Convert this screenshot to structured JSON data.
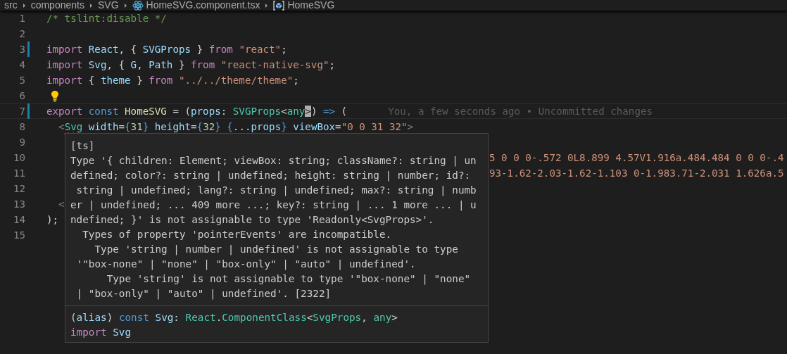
{
  "breadcrumbs": [
    {
      "kind": "text",
      "label": "src"
    },
    {
      "kind": "text",
      "label": "components"
    },
    {
      "kind": "text",
      "label": "SVG"
    },
    {
      "kind": "react",
      "label": "HomeSVG.component.tsx"
    },
    {
      "kind": "symbol",
      "label": "HomeSVG"
    }
  ],
  "lines": [
    {
      "number": "1",
      "modified": false,
      "current": false,
      "tokens": [
        {
          "kind": "comment",
          "text": "/* tslint:disable */"
        }
      ]
    },
    {
      "number": "2",
      "modified": false,
      "current": false
    },
    {
      "number": "3",
      "modified": true,
      "current": false,
      "tokens": [
        {
          "kind": "keyword",
          "text": "import "
        },
        {
          "kind": "var",
          "text": "React"
        },
        {
          "kind": "punc",
          "text": ", { "
        },
        {
          "kind": "var",
          "text": "SVGProps"
        },
        {
          "kind": "punc",
          "text": " } "
        },
        {
          "kind": "keyword",
          "text": "from "
        },
        {
          "kind": "string",
          "text": "\"react\""
        },
        {
          "kind": "punc",
          "text": ";"
        }
      ]
    },
    {
      "number": "4",
      "modified": false,
      "current": false,
      "tokens": [
        {
          "kind": "keyword",
          "text": "import "
        },
        {
          "kind": "var",
          "text": "Svg"
        },
        {
          "kind": "punc",
          "text": ", { "
        },
        {
          "kind": "var",
          "text": "G"
        },
        {
          "kind": "punc",
          "text": ", "
        },
        {
          "kind": "var",
          "text": "Path"
        },
        {
          "kind": "punc",
          "text": " } "
        },
        {
          "kind": "keyword",
          "text": "from "
        },
        {
          "kind": "string",
          "text": "\"react-native-svg\""
        },
        {
          "kind": "punc",
          "text": ";"
        }
      ]
    },
    {
      "number": "5",
      "modified": false,
      "current": false,
      "tokens": [
        {
          "kind": "keyword",
          "text": "import"
        },
        {
          "kind": "punc",
          "text": " { "
        },
        {
          "kind": "var",
          "text": "theme"
        },
        {
          "kind": "punc",
          "text": " } "
        },
        {
          "kind": "keyword",
          "text": "from "
        },
        {
          "kind": "string",
          "text": "\"../../theme/theme\""
        },
        {
          "kind": "punc",
          "text": ";"
        }
      ]
    },
    {
      "number": "6",
      "modified": false,
      "current": false,
      "tokens": [
        {
          "kind": "lightbulb"
        }
      ]
    },
    {
      "number": "7",
      "modified": true,
      "current": true,
      "blame": "You, a few seconds ago • Uncommitted changes",
      "tokens": [
        {
          "kind": "keyword",
          "text": "export "
        },
        {
          "kind": "storage",
          "text": "const "
        },
        {
          "kind": "function",
          "text": "HomeSVG"
        },
        {
          "kind": "punc",
          "text": " = ("
        },
        {
          "kind": "var",
          "text": "props"
        },
        {
          "kind": "punc",
          "text": ": "
        },
        {
          "kind": "type",
          "text": "SVGProps"
        },
        {
          "kind": "punc",
          "text": "<"
        },
        {
          "kind": "type",
          "text": "any"
        },
        {
          "kind": "punc",
          "text": ">",
          "cursor": true
        },
        {
          "kind": "punc",
          "text": ") "
        },
        {
          "kind": "storage",
          "text": "=>"
        },
        {
          "kind": "punc",
          "text": " ("
        }
      ]
    },
    {
      "number": "8",
      "modified": false,
      "current": false,
      "tokens": [
        {
          "kind": "tag",
          "text": "  <"
        },
        {
          "kind": "type",
          "text": "Svg",
          "error": true
        },
        {
          "kind": "var",
          "text": " width"
        },
        {
          "kind": "punc",
          "text": "="
        },
        {
          "kind": "storage",
          "text": "{"
        },
        {
          "kind": "number",
          "text": "31"
        },
        {
          "kind": "storage",
          "text": "}"
        },
        {
          "kind": "var",
          "text": " height"
        },
        {
          "kind": "punc",
          "text": "="
        },
        {
          "kind": "storage",
          "text": "{"
        },
        {
          "kind": "number",
          "text": "32"
        },
        {
          "kind": "storage",
          "text": "} {"
        },
        {
          "kind": "punc",
          "text": "..."
        },
        {
          "kind": "var",
          "text": "props"
        },
        {
          "kind": "storage",
          "text": "}"
        },
        {
          "kind": "var",
          "text": " viewBox"
        },
        {
          "kind": "punc",
          "text": "="
        },
        {
          "kind": "string",
          "text": "\"0 0 31 32\""
        },
        {
          "kind": "tag",
          "text": ">"
        }
      ]
    },
    {
      "number": "9",
      "modified": false,
      "current": false
    },
    {
      "number": "10",
      "modified": false,
      "current": false,
      "tokens": [
        {
          "kind": "fragment",
          "text": "5 0 0 0-.572 0L8.899 4.57V1.916a.484.484 0 0 0-.4"
        }
      ]
    },
    {
      "number": "11",
      "modified": false,
      "current": false,
      "tokens": [
        {
          "kind": "fragment",
          "text": "93-1.62-2.03-1.62-1.103 0-1.983.71-2.031 1.626a.5"
        }
      ]
    },
    {
      "number": "12",
      "modified": false,
      "current": false
    },
    {
      "number": "13",
      "modified": false,
      "current": false,
      "tokens": [
        {
          "kind": "tag",
          "text": "  <"
        }
      ]
    },
    {
      "number": "14",
      "modified": false,
      "current": false,
      "tokens": [
        {
          "kind": "punc",
          "text": ");"
        }
      ]
    },
    {
      "number": "15",
      "modified": false,
      "current": false
    }
  ],
  "hover": {
    "source": "[ts]",
    "message": [
      "Type '{ children: Element; viewBox: string; className?: string | un",
      "defined; color?: string | undefined; height: string | number; id?:",
      " string | undefined; lang?: string | undefined; max?: string | numb",
      "er | undefined; ... 409 more ...; key?: string | ... 1 more ... | u",
      "ndefined; }' is not assignable to type 'Readonly<SvgProps>'.",
      "  Types of property 'pointerEvents' are incompatible.",
      "    Type 'string | number | undefined' is not assignable to type",
      " '\"box-none\" | \"none\" | \"box-only\" | \"auto\" | undefined'.",
      "      Type 'string' is not assignable to type '\"box-none\" | \"none\"",
      " | \"box-only\" | \"auto\" | undefined'. [2322]"
    ],
    "signature": [
      [
        {
          "kind": "punc",
          "text": "("
        },
        {
          "kind": "var",
          "text": "alias"
        },
        {
          "kind": "punc",
          "text": ") "
        },
        {
          "kind": "storage",
          "text": "const "
        },
        {
          "kind": "var",
          "text": "Svg"
        },
        {
          "kind": "punc",
          "text": ": "
        },
        {
          "kind": "type",
          "text": "React"
        },
        {
          "kind": "punc",
          "text": "."
        },
        {
          "kind": "type",
          "text": "ComponentClass"
        },
        {
          "kind": "punc",
          "text": "<"
        },
        {
          "kind": "type",
          "text": "SvgProps"
        },
        {
          "kind": "punc",
          "text": ", "
        },
        {
          "kind": "type",
          "text": "any"
        },
        {
          "kind": "punc",
          "text": ">"
        }
      ],
      [
        {
          "kind": "keyword",
          "text": "import "
        },
        {
          "kind": "var",
          "text": "Svg"
        }
      ]
    ]
  }
}
